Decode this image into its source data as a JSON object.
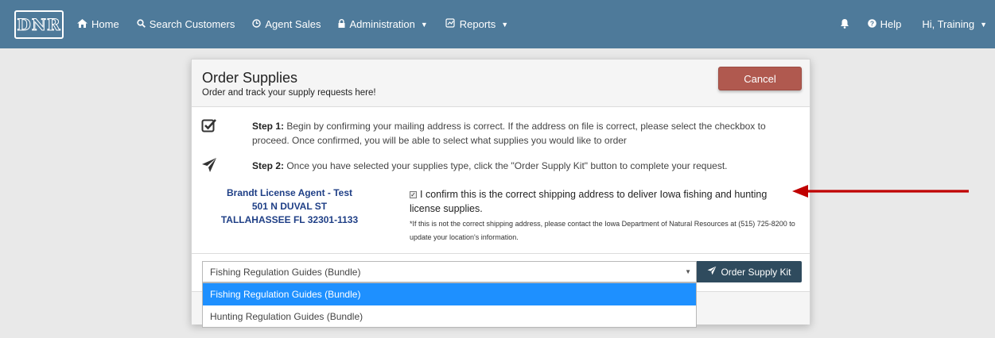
{
  "navbar": {
    "logo_text": "DNR",
    "home": "Home",
    "search_customers": "Search Customers",
    "agent_sales": "Agent Sales",
    "administration": "Administration",
    "reports": "Reports",
    "help": "Help",
    "user": "Hi, Training"
  },
  "card": {
    "title": "Order Supplies",
    "subtitle": "Order and track your supply requests here!",
    "cancel_label": "Cancel"
  },
  "steps": [
    {
      "label": "Step 1:",
      "text": " Begin by confirming your mailing address is correct. If the address on file is correct, please select the checkbox to proceed. Once confirmed, you will be able to select what supplies you would like to order"
    },
    {
      "label": "Step 2:",
      "text": " Once you have selected your supplies type, click the \"Order Supply Kit\" button to complete your request."
    }
  ],
  "address": {
    "name": "Brandt License Agent - Test",
    "street": "501 N DUVAL ST",
    "city": "TALLAHASSEE FL 32301-1133"
  },
  "confirm": {
    "checked": true,
    "label": "I confirm this is the correct shipping address to deliver Iowa fishing and hunting license supplies.",
    "note": "*If this is not the correct shipping address, please contact the Iowa Department of Natural Resources at (515) 725-8200 to update your location's information."
  },
  "supply_select": {
    "value": "Fishing Regulation Guides (Bundle)",
    "options": [
      "Fishing Regulation Guides (Bundle)",
      "Hunting Regulation Guides (Bundle)"
    ]
  },
  "order_label": "Order Supply Kit",
  "colors": {
    "navbar": "#4e7a9a",
    "cancel": "#b0594f",
    "order_button": "#2f4b5e",
    "dropdown_highlight": "#1e90ff",
    "annotation_arrow": "#c00000"
  },
  "icons": [
    "home-icon",
    "search-icon",
    "clock-icon",
    "lock-icon",
    "reports-icon",
    "bell-icon",
    "help-icon",
    "check-square-icon",
    "paper-plane-icon"
  ]
}
